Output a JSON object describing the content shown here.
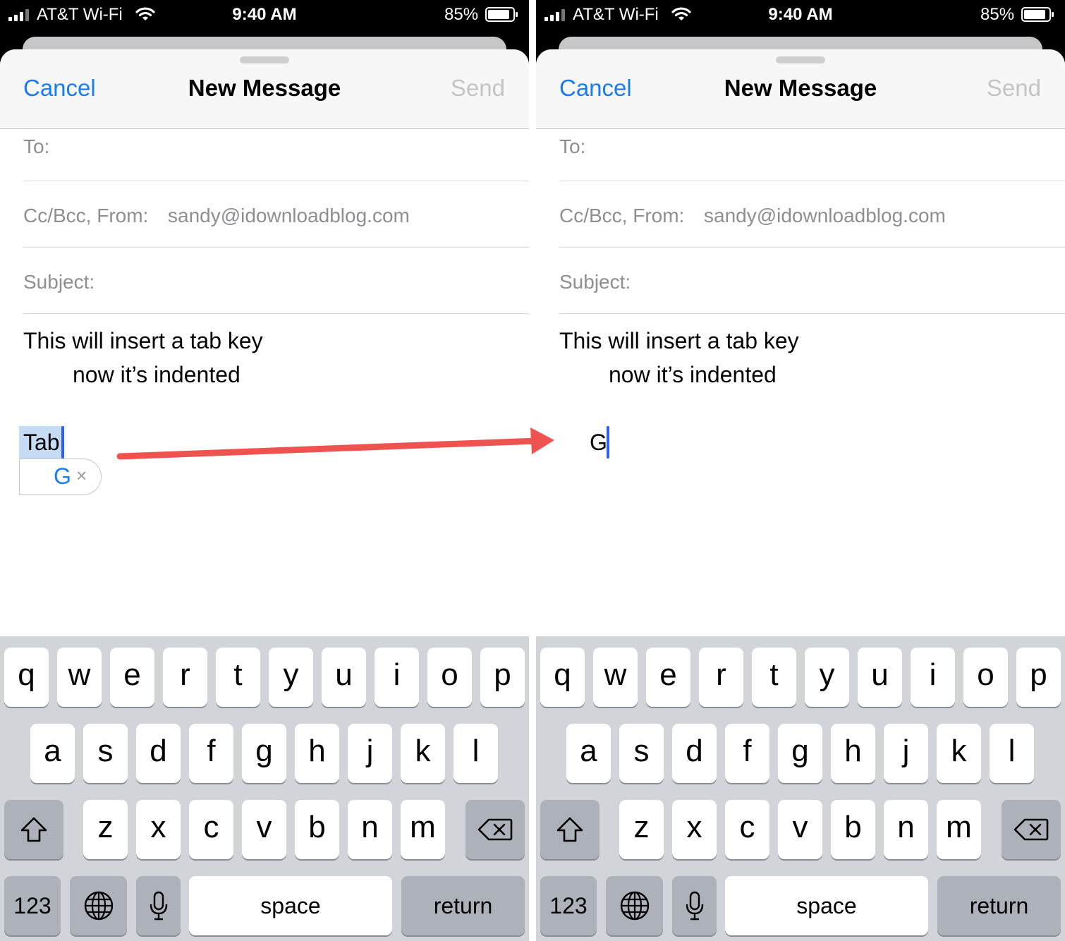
{
  "status_bar": {
    "carrier": "AT&T Wi-Fi",
    "time": "9:40 AM",
    "battery": "85%"
  },
  "compose": {
    "cancel_label": "Cancel",
    "title": "New Message",
    "send_label": "Send",
    "to_label": "To:",
    "from_label": "Cc/Bcc, From:",
    "from_value": "sandy@idownloadblog.com",
    "subject_label": "Subject:",
    "body_line1": "This will insert a tab key",
    "body_line2": "now it’s indented"
  },
  "left_panel": {
    "typed_text": "Tab",
    "suggestion": "G",
    "suggestion_dismiss": "×"
  },
  "right_panel": {
    "typed_text": "G"
  },
  "keyboard": {
    "row1": [
      "q",
      "w",
      "e",
      "r",
      "t",
      "y",
      "u",
      "i",
      "o",
      "p"
    ],
    "row2": [
      "a",
      "s",
      "d",
      "f",
      "g",
      "h",
      "j",
      "k",
      "l"
    ],
    "row3": [
      "z",
      "x",
      "c",
      "v",
      "b",
      "n",
      "m"
    ],
    "numbers_label": "123",
    "space_label": "space",
    "return_label": "return",
    "shift_icon": "shift-icon",
    "delete_icon": "delete-icon",
    "globe_icon": "globe-icon",
    "mic_icon": "microphone-icon"
  },
  "colors": {
    "accent": "#1a7cf5",
    "send_disabled": "#c4c4c6",
    "selection": "#c6dcf5",
    "cursor": "#2f5ef2",
    "arrow": "#ef5350",
    "keyboard_bg": "#d1d4d9"
  }
}
